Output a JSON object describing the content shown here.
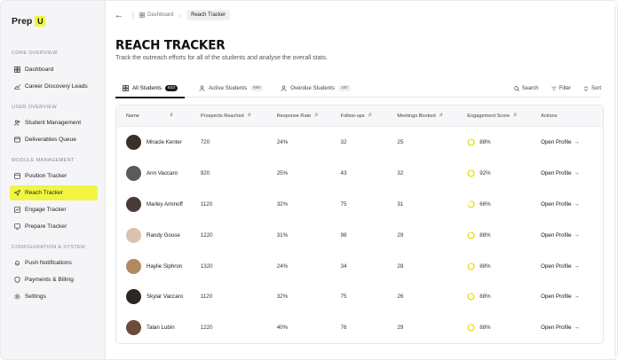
{
  "brand": {
    "name": "Prep",
    "badge": "U"
  },
  "sidebar": {
    "sections": [
      {
        "label": "Core Overview"
      },
      {
        "label": "User Overview"
      },
      {
        "label": "Module Management"
      },
      {
        "label": "Configuration & System"
      }
    ],
    "items": [
      {
        "label": "Dashboard",
        "icon": "grid-icon"
      },
      {
        "label": "Career Discovery Leads",
        "icon": "trend-icon"
      },
      {
        "label": "Student Management",
        "icon": "users-icon"
      },
      {
        "label": "Deliverables Queue",
        "icon": "folder-icon"
      },
      {
        "label": "Position Tracker",
        "icon": "window-icon"
      },
      {
        "label": "Reach Tracker",
        "icon": "send-icon"
      },
      {
        "label": "Engage Tracker",
        "icon": "chart-icon"
      },
      {
        "label": "Prepare Tracker",
        "icon": "monitor-icon"
      },
      {
        "label": "Push Notifications",
        "icon": "bell-icon"
      },
      {
        "label": "Payments & Billing",
        "icon": "shield-icon"
      },
      {
        "label": "Settings",
        "icon": "gear-icon"
      }
    ],
    "active_color": "#f1f542"
  },
  "breadcrumb": {
    "items": [
      "Dashboard",
      "Reach Tracker"
    ]
  },
  "page": {
    "title": "REACH TRACKER",
    "subtitle": "Track the outreach efforts for all of the students and analyse the overall stats."
  },
  "tabs": [
    {
      "label": "All Students",
      "count": "823"
    },
    {
      "label": "Active Students",
      "count": "656"
    },
    {
      "label": "Overdue Students",
      "count": "167"
    }
  ],
  "tools": {
    "search": "Search",
    "filter": "Filter",
    "sort": "Sort"
  },
  "table": {
    "headers": {
      "name": "Name",
      "prospects": "Prospects Reached",
      "response": "Response Rate",
      "followups": "Follow-ups",
      "meetings": "Meetings Booked",
      "engagement": "Engagement Score",
      "actions": "Actions"
    },
    "action_label": "Open Profile",
    "rows": [
      {
        "name": "Miracle Kenter",
        "prospects": "720",
        "response": "24%",
        "followups": "32",
        "meetings": "25",
        "engagement": "88%",
        "score": 0.88,
        "avatar": "#3b2f2a"
      },
      {
        "name": "Ann Vaccaro",
        "prospects": "920",
        "response": "25%",
        "followups": "43",
        "meetings": "32",
        "engagement": "92%",
        "score": 0.92,
        "avatar": "#5a5a5a"
      },
      {
        "name": "Marley Aminoff",
        "prospects": "1120",
        "response": "32%",
        "followups": "75",
        "meetings": "31",
        "engagement": "66%",
        "score": 0.66,
        "avatar": "#4a3a36"
      },
      {
        "name": "Randy Gouse",
        "prospects": "1220",
        "response": "31%",
        "followups": "98",
        "meetings": "29",
        "engagement": "88%",
        "score": 0.88,
        "avatar": "#d9c3ad"
      },
      {
        "name": "Haylie Siphron",
        "prospects": "1320",
        "response": "24%",
        "followups": "34",
        "meetings": "28",
        "engagement": "88%",
        "score": 0.88,
        "avatar": "#b08a5e"
      },
      {
        "name": "Skylar Vaccaro",
        "prospects": "1120",
        "response": "32%",
        "followups": "75",
        "meetings": "26",
        "engagement": "88%",
        "score": 0.88,
        "avatar": "#2e2622"
      },
      {
        "name": "Talan Lubin",
        "prospects": "1220",
        "response": "40%",
        "followups": "76",
        "meetings": "29",
        "engagement": "88%",
        "score": 0.88,
        "avatar": "#6b4b3a"
      }
    ],
    "ring_color": "#e6e000"
  }
}
